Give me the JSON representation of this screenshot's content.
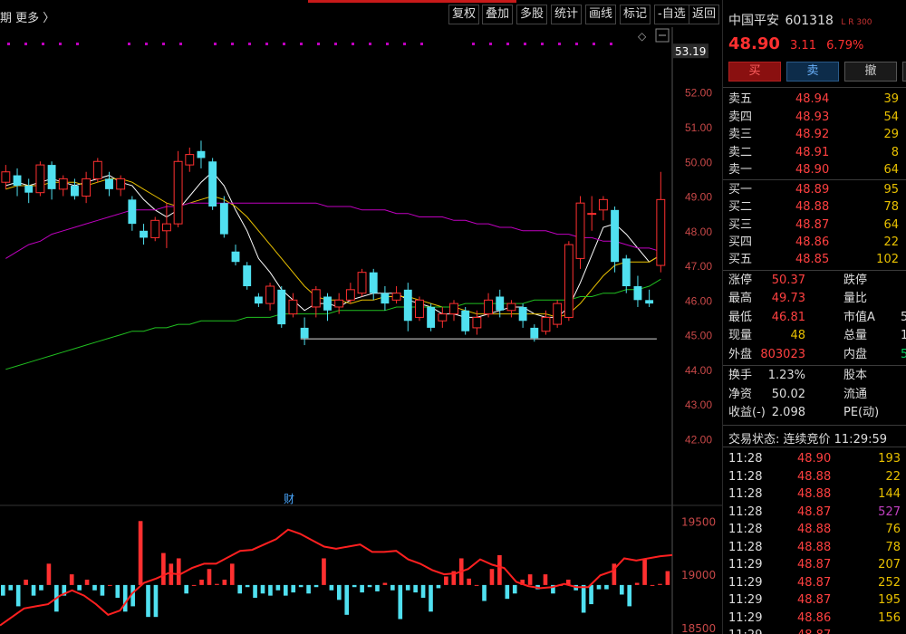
{
  "toolbar": {
    "period_label": "期",
    "more_label": "更多 〉",
    "buttons": [
      "复权",
      "叠加",
      "多股",
      "统计",
      "画线",
      "标记",
      "-自选",
      "返回"
    ]
  },
  "chart_data": [
    {
      "type": "candlestick",
      "title": "",
      "price_axis_ticks": [
        53.19,
        52.0,
        51.0,
        50.0,
        49.0,
        48.0,
        47.0,
        46.0,
        45.0,
        44.0,
        43.0,
        42.0
      ],
      "current_price_label": "53.19",
      "ylim": [
        41.8,
        53.3
      ],
      "candles": [
        {
          "o": 49.4,
          "c": 49.7,
          "h": 49.9,
          "l": 49.2
        },
        {
          "o": 49.6,
          "c": 49.3,
          "h": 49.8,
          "l": 49.0
        },
        {
          "o": 49.3,
          "c": 49.1,
          "h": 49.5,
          "l": 48.8
        },
        {
          "o": 49.1,
          "c": 49.9,
          "h": 50.0,
          "l": 49.0
        },
        {
          "o": 49.9,
          "c": 49.2,
          "h": 50.0,
          "l": 48.9
        },
        {
          "o": 49.2,
          "c": 49.5,
          "h": 49.6,
          "l": 49.0
        },
        {
          "o": 49.3,
          "c": 49.0,
          "h": 49.5,
          "l": 48.9
        },
        {
          "o": 49.0,
          "c": 49.5,
          "h": 49.7,
          "l": 48.8
        },
        {
          "o": 49.5,
          "c": 50.0,
          "h": 50.1,
          "l": 49.4
        },
        {
          "o": 49.5,
          "c": 49.2,
          "h": 49.7,
          "l": 49.0
        },
        {
          "o": 49.2,
          "c": 49.5,
          "h": 49.6,
          "l": 49.0
        },
        {
          "o": 48.9,
          "c": 48.2,
          "h": 49.0,
          "l": 48.0
        },
        {
          "o": 48.0,
          "c": 47.8,
          "h": 48.2,
          "l": 47.6
        },
        {
          "o": 47.8,
          "c": 48.3,
          "h": 48.4,
          "l": 47.7
        },
        {
          "o": 48.0,
          "c": 48.2,
          "h": 48.8,
          "l": 47.5
        },
        {
          "o": 48.2,
          "c": 50.0,
          "h": 50.3,
          "l": 48.1
        },
        {
          "o": 49.9,
          "c": 50.2,
          "h": 50.4,
          "l": 49.7
        },
        {
          "o": 50.3,
          "c": 50.1,
          "h": 50.6,
          "l": 49.8
        },
        {
          "o": 50.0,
          "c": 48.7,
          "h": 50.1,
          "l": 48.6
        },
        {
          "o": 48.8,
          "c": 47.9,
          "h": 49.0,
          "l": 47.8
        },
        {
          "o": 47.4,
          "c": 47.1,
          "h": 47.6,
          "l": 47.0
        },
        {
          "o": 47.0,
          "c": 46.4,
          "h": 47.1,
          "l": 46.3
        },
        {
          "o": 46.1,
          "c": 45.9,
          "h": 46.2,
          "l": 45.8
        },
        {
          "o": 45.9,
          "c": 46.4,
          "h": 46.5,
          "l": 45.7
        },
        {
          "o": 46.3,
          "c": 45.3,
          "h": 46.4,
          "l": 45.2
        },
        {
          "o": 45.6,
          "c": 46.0,
          "h": 46.2,
          "l": 45.5
        },
        {
          "o": 45.2,
          "c": 44.9,
          "h": 45.5,
          "l": 44.7
        },
        {
          "o": 45.8,
          "c": 46.3,
          "h": 46.4,
          "l": 45.5
        },
        {
          "o": 46.1,
          "c": 45.7,
          "h": 46.2,
          "l": 45.4
        },
        {
          "o": 45.8,
          "c": 46.0,
          "h": 46.2,
          "l": 45.6
        },
        {
          "o": 46.0,
          "c": 46.3,
          "h": 46.5,
          "l": 45.9
        },
        {
          "o": 46.2,
          "c": 46.8,
          "h": 46.9,
          "l": 46.1
        },
        {
          "o": 46.8,
          "c": 46.2,
          "h": 46.9,
          "l": 46.0
        },
        {
          "o": 46.2,
          "c": 45.9,
          "h": 46.4,
          "l": 45.7
        },
        {
          "o": 46.0,
          "c": 46.2,
          "h": 46.4,
          "l": 45.9
        },
        {
          "o": 46.3,
          "c": 45.4,
          "h": 46.5,
          "l": 45.1
        },
        {
          "o": 45.5,
          "c": 46.0,
          "h": 46.1,
          "l": 45.4
        },
        {
          "o": 45.8,
          "c": 45.2,
          "h": 45.9,
          "l": 45.1
        },
        {
          "o": 45.4,
          "c": 45.6,
          "h": 45.8,
          "l": 45.2
        },
        {
          "o": 45.6,
          "c": 45.9,
          "h": 46.0,
          "l": 45.4
        },
        {
          "o": 45.7,
          "c": 45.1,
          "h": 45.8,
          "l": 45.0
        },
        {
          "o": 45.2,
          "c": 45.5,
          "h": 45.7,
          "l": 45.0
        },
        {
          "o": 45.6,
          "c": 46.0,
          "h": 46.2,
          "l": 45.5
        },
        {
          "o": 46.1,
          "c": 45.7,
          "h": 46.3,
          "l": 45.5
        },
        {
          "o": 45.7,
          "c": 45.9,
          "h": 46.0,
          "l": 45.5
        },
        {
          "o": 45.8,
          "c": 45.4,
          "h": 45.9,
          "l": 45.2
        },
        {
          "o": 45.2,
          "c": 44.9,
          "h": 45.3,
          "l": 44.8
        },
        {
          "o": 45.1,
          "c": 45.5,
          "h": 45.7,
          "l": 45.0
        },
        {
          "o": 45.3,
          "c": 45.9,
          "h": 46.0,
          "l": 45.2
        },
        {
          "o": 45.5,
          "c": 47.6,
          "h": 47.7,
          "l": 45.4
        },
        {
          "o": 47.2,
          "c": 48.8,
          "h": 49.0,
          "l": 46.9
        },
        {
          "o": 48.5,
          "c": 48.5,
          "h": 49.0,
          "l": 48.0
        },
        {
          "o": 48.6,
          "c": 48.9,
          "h": 49.0,
          "l": 48.3
        },
        {
          "o": 48.6,
          "c": 47.1,
          "h": 48.7,
          "l": 46.8
        },
        {
          "o": 47.2,
          "c": 46.4,
          "h": 47.3,
          "l": 46.2
        },
        {
          "o": 46.4,
          "c": 46.0,
          "h": 46.7,
          "l": 45.8
        },
        {
          "o": 46.0,
          "c": 45.9,
          "h": 46.3,
          "l": 45.8
        },
        {
          "o": 47.0,
          "c": 48.9,
          "h": 49.7,
          "l": 46.8
        }
      ],
      "ma_series": [
        {
          "color": "#ffffff",
          "values": [
            49.3,
            49.4,
            49.3,
            49.4,
            49.5,
            49.4,
            49.3,
            49.4,
            49.5,
            49.6,
            49.4,
            49.3,
            48.9,
            48.6,
            48.4,
            48.6,
            49.0,
            49.4,
            49.7,
            49.3,
            48.6,
            48.0,
            47.2,
            46.8,
            46.3,
            46.0,
            45.7,
            45.9,
            45.9,
            45.8,
            46.0,
            46.1,
            46.2,
            46.2,
            46.2,
            46.0,
            45.9,
            45.8,
            45.6,
            45.6,
            45.5,
            45.5,
            45.6,
            45.7,
            45.8,
            45.8,
            45.6,
            45.5,
            45.5,
            45.8,
            46.5,
            47.3,
            48.1,
            48.2,
            47.9,
            47.5,
            47.1,
            47.3
          ]
        },
        {
          "color": "#e8c000",
          "values": [
            49.2,
            49.3,
            49.3,
            49.3,
            49.4,
            49.4,
            49.4,
            49.3,
            49.4,
            49.5,
            49.5,
            49.4,
            49.2,
            49.0,
            48.8,
            48.7,
            48.8,
            48.9,
            49.0,
            48.9,
            48.7,
            48.4,
            48.0,
            47.6,
            47.2,
            46.8,
            46.4,
            46.1,
            46.0,
            46.0,
            45.9,
            46.0,
            46.0,
            46.1,
            46.1,
            46.1,
            46.0,
            45.9,
            45.8,
            45.8,
            45.7,
            45.6,
            45.6,
            45.6,
            45.6,
            45.6,
            45.6,
            45.6,
            45.5,
            45.6,
            45.9,
            46.3,
            46.7,
            47.0,
            47.1,
            47.1,
            47.1,
            47.3
          ]
        },
        {
          "color": "#c000c0",
          "values": [
            47.2,
            47.4,
            47.6,
            47.7,
            47.9,
            48.0,
            48.1,
            48.2,
            48.3,
            48.4,
            48.5,
            48.6,
            48.6,
            48.6,
            48.7,
            48.7,
            48.8,
            48.8,
            48.8,
            48.8,
            48.8,
            48.8,
            48.8,
            48.8,
            48.8,
            48.8,
            48.8,
            48.8,
            48.7,
            48.7,
            48.7,
            48.6,
            48.6,
            48.6,
            48.5,
            48.5,
            48.4,
            48.4,
            48.4,
            48.3,
            48.3,
            48.2,
            48.2,
            48.1,
            48.1,
            48.0,
            48.0,
            48.0,
            47.9,
            47.9,
            47.8,
            47.8,
            47.7,
            47.7,
            47.6,
            47.5,
            47.5,
            47.4
          ]
        },
        {
          "color": "#20c020",
          "values": [
            44.0,
            44.1,
            44.2,
            44.3,
            44.4,
            44.5,
            44.6,
            44.7,
            44.8,
            44.9,
            45.0,
            45.1,
            45.1,
            45.2,
            45.2,
            45.3,
            45.3,
            45.4,
            45.4,
            45.4,
            45.4,
            45.5,
            45.5,
            45.5,
            45.6,
            45.6,
            45.6,
            45.6,
            45.6,
            45.7,
            45.7,
            45.7,
            45.7,
            45.7,
            45.8,
            45.8,
            45.8,
            45.8,
            45.8,
            45.8,
            45.9,
            45.9,
            45.9,
            45.9,
            45.9,
            45.9,
            46.0,
            46.0,
            46.0,
            46.0,
            46.1,
            46.1,
            46.2,
            46.2,
            46.3,
            46.3,
            46.4,
            46.6
          ]
        }
      ],
      "support_line": {
        "color": "#dddddd",
        "from_index": 26,
        "to_index": 57,
        "value": 44.88
      },
      "finance_marker": "财"
    },
    {
      "type": "bar",
      "title": "",
      "axis_ticks": [
        "19500",
        "19000",
        "18500"
      ],
      "baseline": 18900,
      "ylim": [
        18440,
        19630
      ],
      "values": [
        18800,
        18850,
        18700,
        18950,
        18800,
        18850,
        19100,
        18650,
        18800,
        19000,
        18850,
        18950,
        18850,
        18800,
        18900,
        18780,
        18650,
        18700,
        19500,
        18600,
        18600,
        19200,
        19100,
        19150,
        18820,
        18900,
        18950,
        19050,
        18910,
        18950,
        19100,
        18820,
        18880,
        18780,
        18820,
        18800,
        18850,
        18800,
        18830,
        18880,
        18820,
        18880,
        19150,
        18850,
        18760,
        18620,
        18880,
        18830,
        18880,
        18840,
        18920,
        18850,
        18580,
        18850,
        18830,
        18780,
        18650,
        18870,
        18980,
        19030,
        19150,
        18960,
        18900,
        18750,
        19050,
        19180,
        18770,
        18820,
        18950,
        19000,
        18860,
        19000,
        18820,
        18900,
        18950,
        18850,
        18640,
        18720,
        18860,
        18860,
        19100,
        18810,
        18700,
        18920,
        19140,
        18900,
        18910,
        19030
      ],
      "line_values": [
        18520,
        18600,
        18680,
        18700,
        18720,
        18800,
        18850,
        18800,
        18720,
        18620,
        18660,
        18820,
        18920,
        18960,
        19010,
        19000,
        19060,
        19100,
        19100,
        19160,
        19220,
        19230,
        19280,
        19330,
        19420,
        19380,
        19320,
        19260,
        19240,
        19260,
        19280,
        19210,
        19210,
        19220,
        19140,
        19100,
        19040,
        19000,
        19010,
        19050,
        19140,
        19090,
        19060,
        18930,
        18890,
        18870,
        18880,
        18910,
        18880,
        18880,
        18990,
        19030,
        19150,
        19130,
        19150,
        19170,
        19180
      ]
    }
  ],
  "stock": {
    "name": "中国平安",
    "code": "601318",
    "tags": "L R 300",
    "price": "48.90",
    "change": "3.11",
    "change_pct": "6.79%"
  },
  "trade_buttons": {
    "buy": "买",
    "sell": "卖",
    "cancel": "撤",
    "extra": ""
  },
  "order_book": {
    "asks": [
      {
        "label": "卖五",
        "price": "48.94",
        "vol": "39"
      },
      {
        "label": "卖四",
        "price": "48.93",
        "vol": "54"
      },
      {
        "label": "卖三",
        "price": "48.92",
        "vol": "29"
      },
      {
        "label": "卖二",
        "price": "48.91",
        "vol": "8"
      },
      {
        "label": "卖一",
        "price": "48.90",
        "vol": "64"
      }
    ],
    "bids": [
      {
        "label": "买一",
        "price": "48.89",
        "vol": "95"
      },
      {
        "label": "买二",
        "price": "48.88",
        "vol": "78"
      },
      {
        "label": "买三",
        "price": "48.87",
        "vol": "64"
      },
      {
        "label": "买四",
        "price": "48.86",
        "vol": "22"
      },
      {
        "label": "买五",
        "price": "48.85",
        "vol": "102"
      }
    ]
  },
  "stats": {
    "limit_up_label": "涨停",
    "limit_up": "50.37",
    "limit_down_label": "跌停",
    "limit_down": "",
    "high_label": "最高",
    "high": "49.73",
    "vol_ratio_label": "量比",
    "vol_ratio": "",
    "low_label": "最低",
    "low": "46.81",
    "mcap_a_label": "市值A",
    "mcap_a": "5",
    "current_vol_label": "现量",
    "current_vol": "48",
    "total_vol_label": "总量",
    "total_vol": "1",
    "outer_label": "外盘",
    "outer": "803023",
    "inner_label": "内盘",
    "inner": "5",
    "turnover_label": "换手",
    "turnover": "1.23%",
    "shares_label": "股本",
    "shares": "",
    "nav_label": "净资",
    "nav": "50.02",
    "float_label": "流通",
    "float": "",
    "eps_label": "收益(-)",
    "eps": "2.098",
    "pe_label": "PE(动)",
    "pe": ""
  },
  "status_line": "交易状态: 连续竞价 11:29:59",
  "ticks": [
    {
      "t": "11:28",
      "p": "48.90",
      "v": "193",
      "c": "#e8c000"
    },
    {
      "t": "11:28",
      "p": "48.88",
      "v": "22",
      "c": "#e8c000"
    },
    {
      "t": "11:28",
      "p": "48.88",
      "v": "144",
      "c": "#e8c000"
    },
    {
      "t": "11:28",
      "p": "48.87",
      "v": "527",
      "c": "#c040c0"
    },
    {
      "t": "11:28",
      "p": "48.88",
      "v": "76",
      "c": "#e8c000"
    },
    {
      "t": "11:28",
      "p": "48.88",
      "v": "78",
      "c": "#e8c000"
    },
    {
      "t": "11:29",
      "p": "48.87",
      "v": "207",
      "c": "#e8c000"
    },
    {
      "t": "11:29",
      "p": "48.87",
      "v": "252",
      "c": "#e8c000"
    },
    {
      "t": "11:29",
      "p": "48.87",
      "v": "195",
      "c": "#e8c000"
    },
    {
      "t": "11:29",
      "p": "48.86",
      "v": "156",
      "c": "#e8c000"
    },
    {
      "t": "11:29",
      "p": "48.87",
      "v": "",
      "c": "#e8c000"
    }
  ],
  "colors": {
    "up": "#ff3030",
    "down": "#50e0f0",
    "magenta_dots": "#c000c0"
  }
}
